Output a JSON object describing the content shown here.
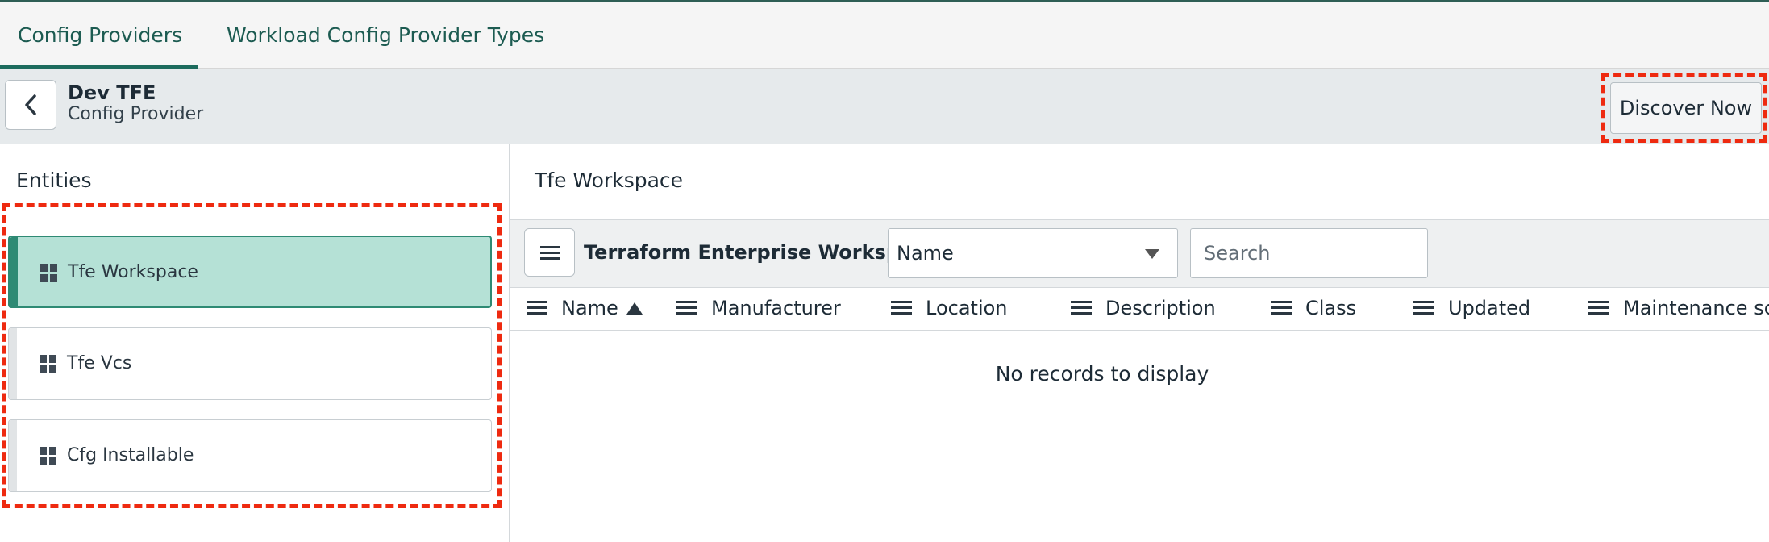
{
  "tabs": [
    {
      "label": "Config Providers",
      "active": true
    },
    {
      "label": "Workload Config Provider Types",
      "active": false
    }
  ],
  "header": {
    "title": "Dev TFE",
    "subtitle": "Config Provider",
    "back_icon": "chevron-left-icon",
    "action_label": "Discover Now"
  },
  "left": {
    "heading": "Entities",
    "items": [
      {
        "label": "Tfe Workspace",
        "active": true,
        "icon": "grid-icon"
      },
      {
        "label": "Tfe Vcs",
        "active": false,
        "icon": "grid-icon"
      },
      {
        "label": "Cfg Installable",
        "active": false,
        "icon": "grid-icon"
      }
    ]
  },
  "right": {
    "heading": "Tfe Workspace",
    "list_title": "Terraform Enterprise Workspaces",
    "filter_field": "Name",
    "search_placeholder": "Search",
    "columns": [
      {
        "label": "Name",
        "sorted": "asc"
      },
      {
        "label": "Manufacturer"
      },
      {
        "label": "Location"
      },
      {
        "label": "Description"
      },
      {
        "label": "Class"
      },
      {
        "label": "Updated"
      },
      {
        "label": "Maintenance sch"
      }
    ],
    "empty_message": "No records to display"
  },
  "colors": {
    "accent": "#1c6b5d",
    "active_item_bg": "#b5e1d6",
    "annotation": "#ee2a10"
  }
}
